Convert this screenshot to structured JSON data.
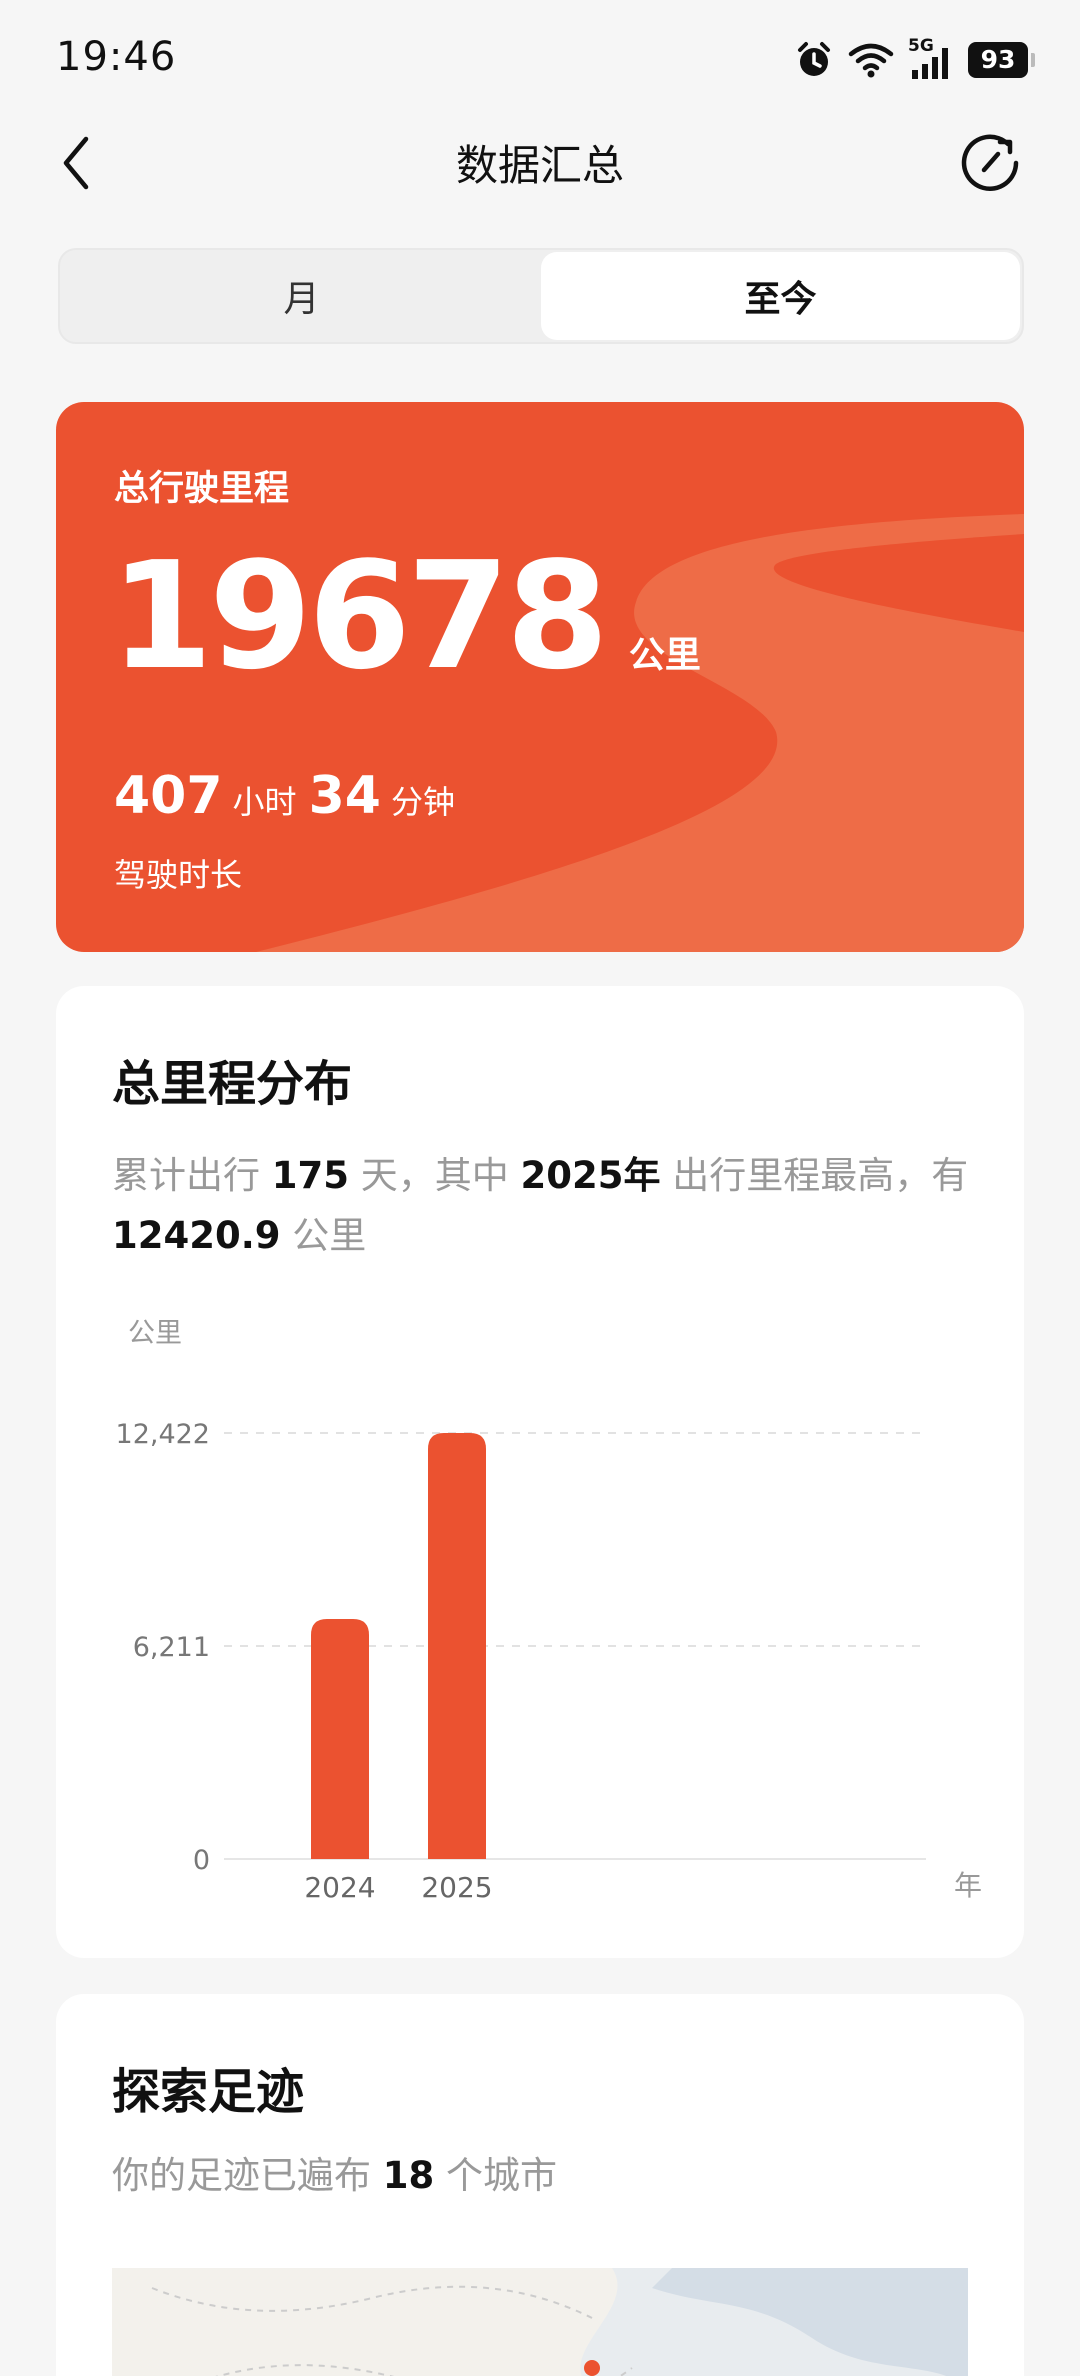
{
  "status_bar": {
    "time": "19:46",
    "network": "5G",
    "battery": "93"
  },
  "header": {
    "title": "数据汇总",
    "back_icon": "chevron-left-icon",
    "refresh_icon": "refresh-icon"
  },
  "segments": [
    {
      "label": "月",
      "active": false
    },
    {
      "label": "至今",
      "active": true
    }
  ],
  "summary": {
    "label": "总行驶里程",
    "distance": "19678",
    "distance_unit": "公里",
    "hours": "407",
    "hours_unit": "小时",
    "minutes": "34",
    "minutes_unit": "分钟",
    "duration_label": "驾驶时长",
    "color": "#eb5230"
  },
  "distribution": {
    "title": "总里程分布",
    "desc_prefix": "累计出行",
    "days": "175",
    "desc_days_unit": "天，其中",
    "top_year": "2025年",
    "desc_mid": "出行里程最高，有",
    "top_distance": "12420.9",
    "desc_unit": "公里"
  },
  "chart_data": {
    "type": "bar",
    "categories": [
      "2024",
      "2025"
    ],
    "values": [
      7000,
      12420.9
    ],
    "ylabel": "公里",
    "xlabel": "年",
    "yticks": [
      "0",
      "6,211",
      "12,422"
    ],
    "ytick_values": [
      0,
      6211,
      12422
    ],
    "ylim": [
      0,
      12422
    ],
    "grid": true,
    "color": "#eb5230"
  },
  "footprint": {
    "title": "探索足迹",
    "desc_prefix": "你的足迹已遍布",
    "cities": "18",
    "desc_suffix": "个城市"
  }
}
